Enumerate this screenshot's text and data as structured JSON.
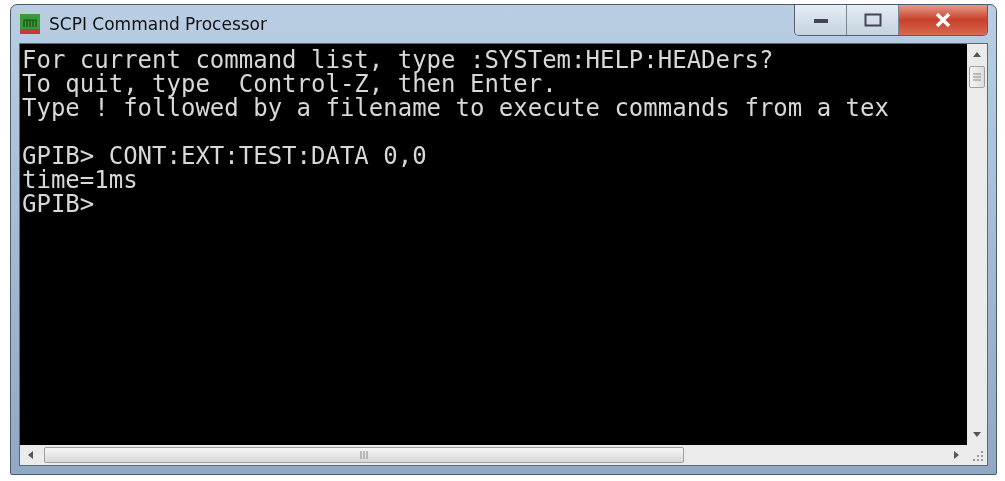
{
  "window": {
    "title": "SCPI Command Processor"
  },
  "console": {
    "blocks": [
      [
        "For current command list, type :SYSTem:HELP:HEADers?",
        "To quit, type  Control-Z, then Enter.",
        "Type ! followed by a filename to execute commands from a tex"
      ],
      [
        "GPIB> CONT:EXT:TEST:DATA 0,0",
        "time=1ms",
        "GPIB>"
      ]
    ]
  }
}
